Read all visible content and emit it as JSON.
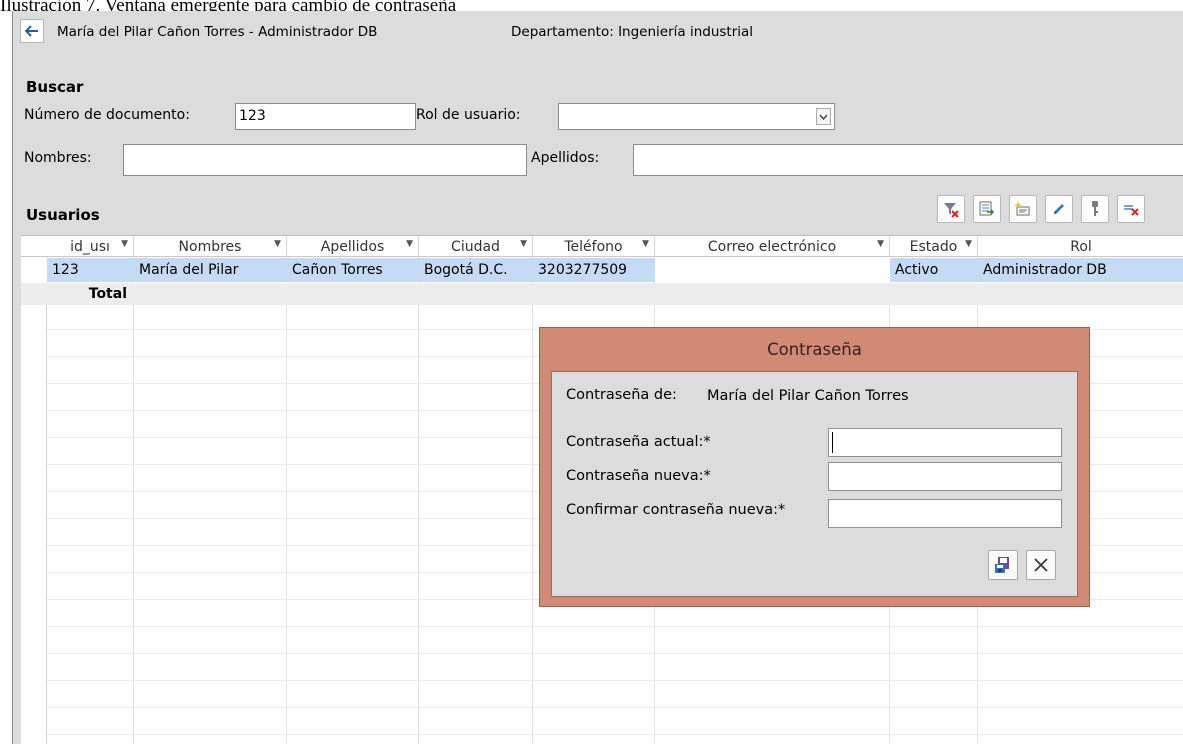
{
  "document": {
    "caption": "Ilustración 7. Ventana emergente para cambio de contraseña"
  },
  "header": {
    "user": "María del Pilar Cañon Torres - Administrador DB",
    "department": "Departamento: Ingeniería industrial"
  },
  "search": {
    "section_title": "Buscar",
    "doc_label": "Número de documento:",
    "doc_value": "123",
    "role_label": "Rol de usuario:",
    "role_value": "",
    "names_label": "Nombres:",
    "names_value": "",
    "surnames_label": "Apellidos:",
    "surnames_value": ""
  },
  "users": {
    "section_title": "Usuarios",
    "toolbar": [
      "clear-filter-icon",
      "export-icon",
      "new-record-icon",
      "edit-icon",
      "password-key-icon",
      "delete-record-icon"
    ],
    "columns": [
      "id_usı",
      "Nombres",
      "Apellidos",
      "Ciudad",
      "Teléfono",
      "Correo electrónico",
      "Estado",
      "Rol"
    ],
    "rows": [
      {
        "id": "123",
        "nombres": "María del Pilar",
        "apellidos": "Cañon Torres",
        "ciudad": "Bogotá D.C.",
        "telefono": "3203277509",
        "correo": "",
        "estado": "Activo",
        "rol": "Administrador DB"
      }
    ],
    "total_label": "Total"
  },
  "dialog": {
    "title": "Contraseña",
    "owner_label": "Contraseña de:",
    "owner_value": "María del Pilar Cañon Torres",
    "current_label": "Contraseña actual:*",
    "new_label": "Contraseña nueva:*",
    "confirm_label": "Confirmar contraseña nueva:*",
    "current_value": "",
    "new_value": "",
    "confirm_value": ""
  },
  "colors": {
    "form_background": "#dcdcdc",
    "dialog_frame": "#d18a76",
    "selected_row": "#c4daf5"
  }
}
